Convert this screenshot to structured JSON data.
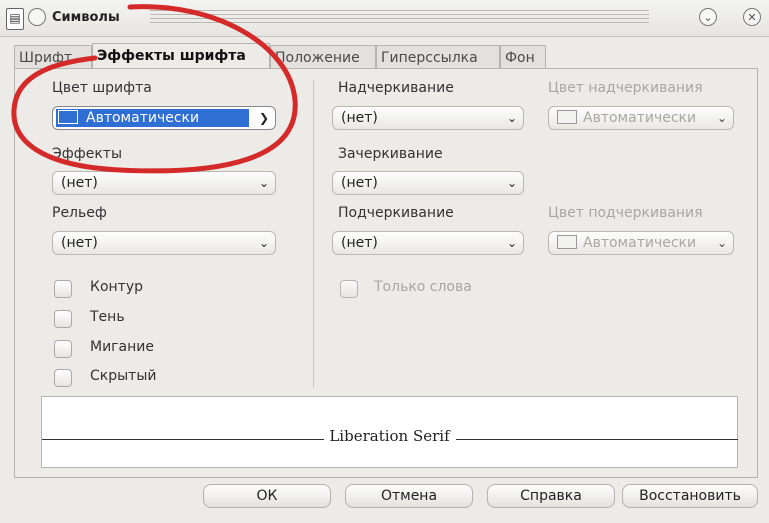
{
  "window": {
    "title": "Символы",
    "app_icon": "document-icon"
  },
  "tabs": [
    {
      "label": "Шрифт",
      "active": false
    },
    {
      "label": "Эффекты шрифта",
      "active": true
    },
    {
      "label": "Положение",
      "active": false
    },
    {
      "label": "Гиперссылка",
      "active": false
    },
    {
      "label": "Фон",
      "active": false
    }
  ],
  "left": {
    "font_color_label": "Цвет шрифта",
    "font_color_value": "Автоматически",
    "effects_label": "Эффекты",
    "effects_value": "(нет)",
    "relief_label": "Рельеф",
    "relief_value": "(нет)",
    "checkboxes": [
      "Контур",
      "Тень",
      "Мигание",
      "Скрытый"
    ]
  },
  "right": {
    "overline_label": "Надчеркивание",
    "overline_value": "(нет)",
    "overline_color_label": "Цвет надчеркивания",
    "overline_color_value": "Автоматически",
    "strike_label": "Зачеркивание",
    "strike_value": "(нет)",
    "underline_label": "Подчеркивание",
    "underline_value": "(нет)",
    "underline_color_label": "Цвет подчеркивания",
    "underline_color_value": "Автоматически",
    "words_only_label": "Только слова"
  },
  "preview": {
    "text": "Liberation Serif"
  },
  "buttons": {
    "ok": "ОК",
    "cancel": "Отмена",
    "help": "Справка",
    "reset": "Восстановить"
  },
  "colors": {
    "selection": "#2f6fd3",
    "annotation": "#d42a2a"
  }
}
